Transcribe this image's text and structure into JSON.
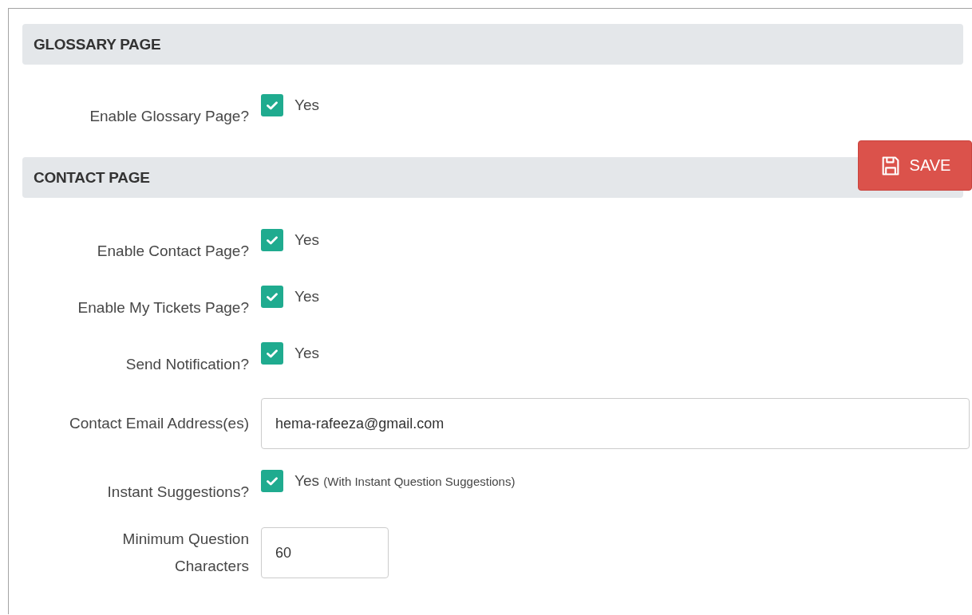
{
  "sections": [
    {
      "title": "GLOSSARY PAGE",
      "rows": [
        {
          "kind": "checkbox",
          "label": "Enable Glossary Page?",
          "checked": true,
          "option": "Yes"
        }
      ]
    },
    {
      "title": "CONTACT PAGE",
      "rows": [
        {
          "kind": "checkbox",
          "label": "Enable Contact Page?",
          "checked": true,
          "option": "Yes"
        },
        {
          "kind": "checkbox",
          "label": "Enable My Tickets Page?",
          "checked": true,
          "option": "Yes"
        },
        {
          "kind": "checkbox",
          "label": "Send Notification?",
          "checked": true,
          "option": "Yes"
        },
        {
          "kind": "input",
          "label": "Contact Email Address(es)",
          "value": "hema-rafeeza@gmail.com"
        },
        {
          "kind": "checkbox",
          "label": "Instant Suggestions?",
          "checked": true,
          "option": "Yes",
          "note": "(With Instant Question Suggestions)"
        },
        {
          "kind": "shortinput",
          "label": "Minimum Question Characters",
          "value": "60"
        }
      ]
    }
  ],
  "save_button": {
    "label": "SAVE"
  }
}
